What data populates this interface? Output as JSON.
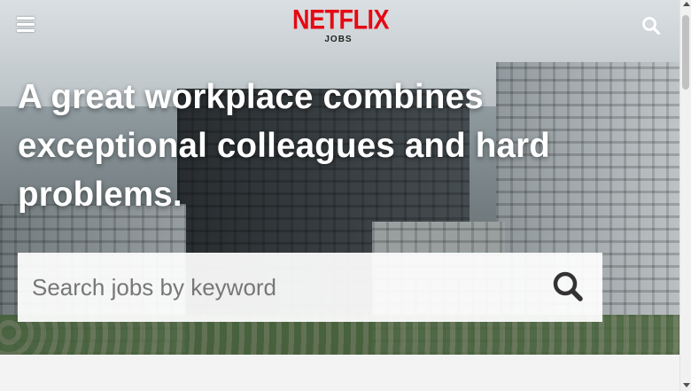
{
  "header": {
    "logo_text": "NETFLIX",
    "logo_sub": "JOBS",
    "menu_icon": "hamburger-menu-icon",
    "search_icon": "search-icon"
  },
  "hero": {
    "headline": "A great workplace combines exceptional colleagues and hard problems.",
    "search": {
      "placeholder": "Search jobs by keyword",
      "value": "",
      "submit_icon": "search-icon"
    }
  },
  "colors": {
    "brand": "#e50914",
    "headline": "#ffffff"
  }
}
